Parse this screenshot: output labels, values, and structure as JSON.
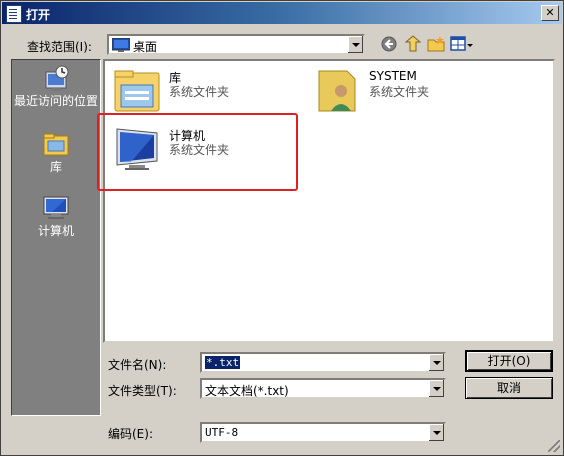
{
  "window": {
    "title": "打开"
  },
  "lookin": {
    "label": "查找范围(I):",
    "value": "桌面"
  },
  "places": [
    {
      "label": "最近访问的位置"
    },
    {
      "label": "库"
    },
    {
      "label": "计算机"
    }
  ],
  "files": [
    {
      "name": "库",
      "desc": "系统文件夹"
    },
    {
      "name": "SYSTEM",
      "desc": "系统文件夹"
    },
    {
      "name": "计算机",
      "desc": "系统文件夹"
    }
  ],
  "filename": {
    "label": "文件名(N):",
    "value": "*.txt"
  },
  "filetype": {
    "label": "文件类型(T):",
    "value": "文本文档(*.txt)"
  },
  "encoding": {
    "label": "编码(E):",
    "value": "UTF-8"
  },
  "buttons": {
    "open": "打开(O)",
    "cancel": "取消"
  },
  "colors": {
    "highlight": "#e02020",
    "titlebar": "#0a246a",
    "selection": "#0a246a"
  }
}
